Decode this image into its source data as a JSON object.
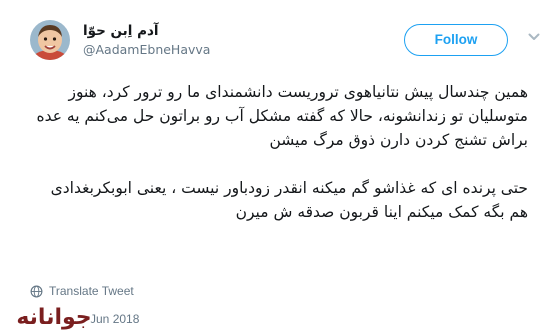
{
  "author": {
    "display_name": "آدم اِبن حوّا",
    "handle": "@AadamEbneHavva",
    "avatar_icon": "child-photo-avatar"
  },
  "follow_button": {
    "label": "Follow"
  },
  "menu": {
    "icon": "chevron-down-icon"
  },
  "tweet": {
    "paragraphs": [
      "همین چندسال پیش نتانیاهوی تروریست دانشمندای ما رو ترور کرد، هنوز متوسلیان تو زندانشونه، حالا که گفته مشکل آب رو براتون حل می‌کنم یه عده براش تشنج کردن دارن ذوق مرگ میشن",
      "حتی پرنده ای که غذاشو گم میکنه انقدر زودباور نیست ، یعنی ابوبکربغدادی هم بگه کمک میکنم اینا قربون صدقه ش میرن"
    ]
  },
  "translate": {
    "label": "Translate Tweet",
    "icon": "globe-icon"
  },
  "timestamp": "0 Jun 2018",
  "watermark": {
    "text": "جوانانه",
    "icon": "site-watermark-logo"
  },
  "colors": {
    "accent": "#1da1f2",
    "text_primary": "#14171a",
    "text_secondary": "#657786",
    "watermark": "#7a1f1f"
  }
}
